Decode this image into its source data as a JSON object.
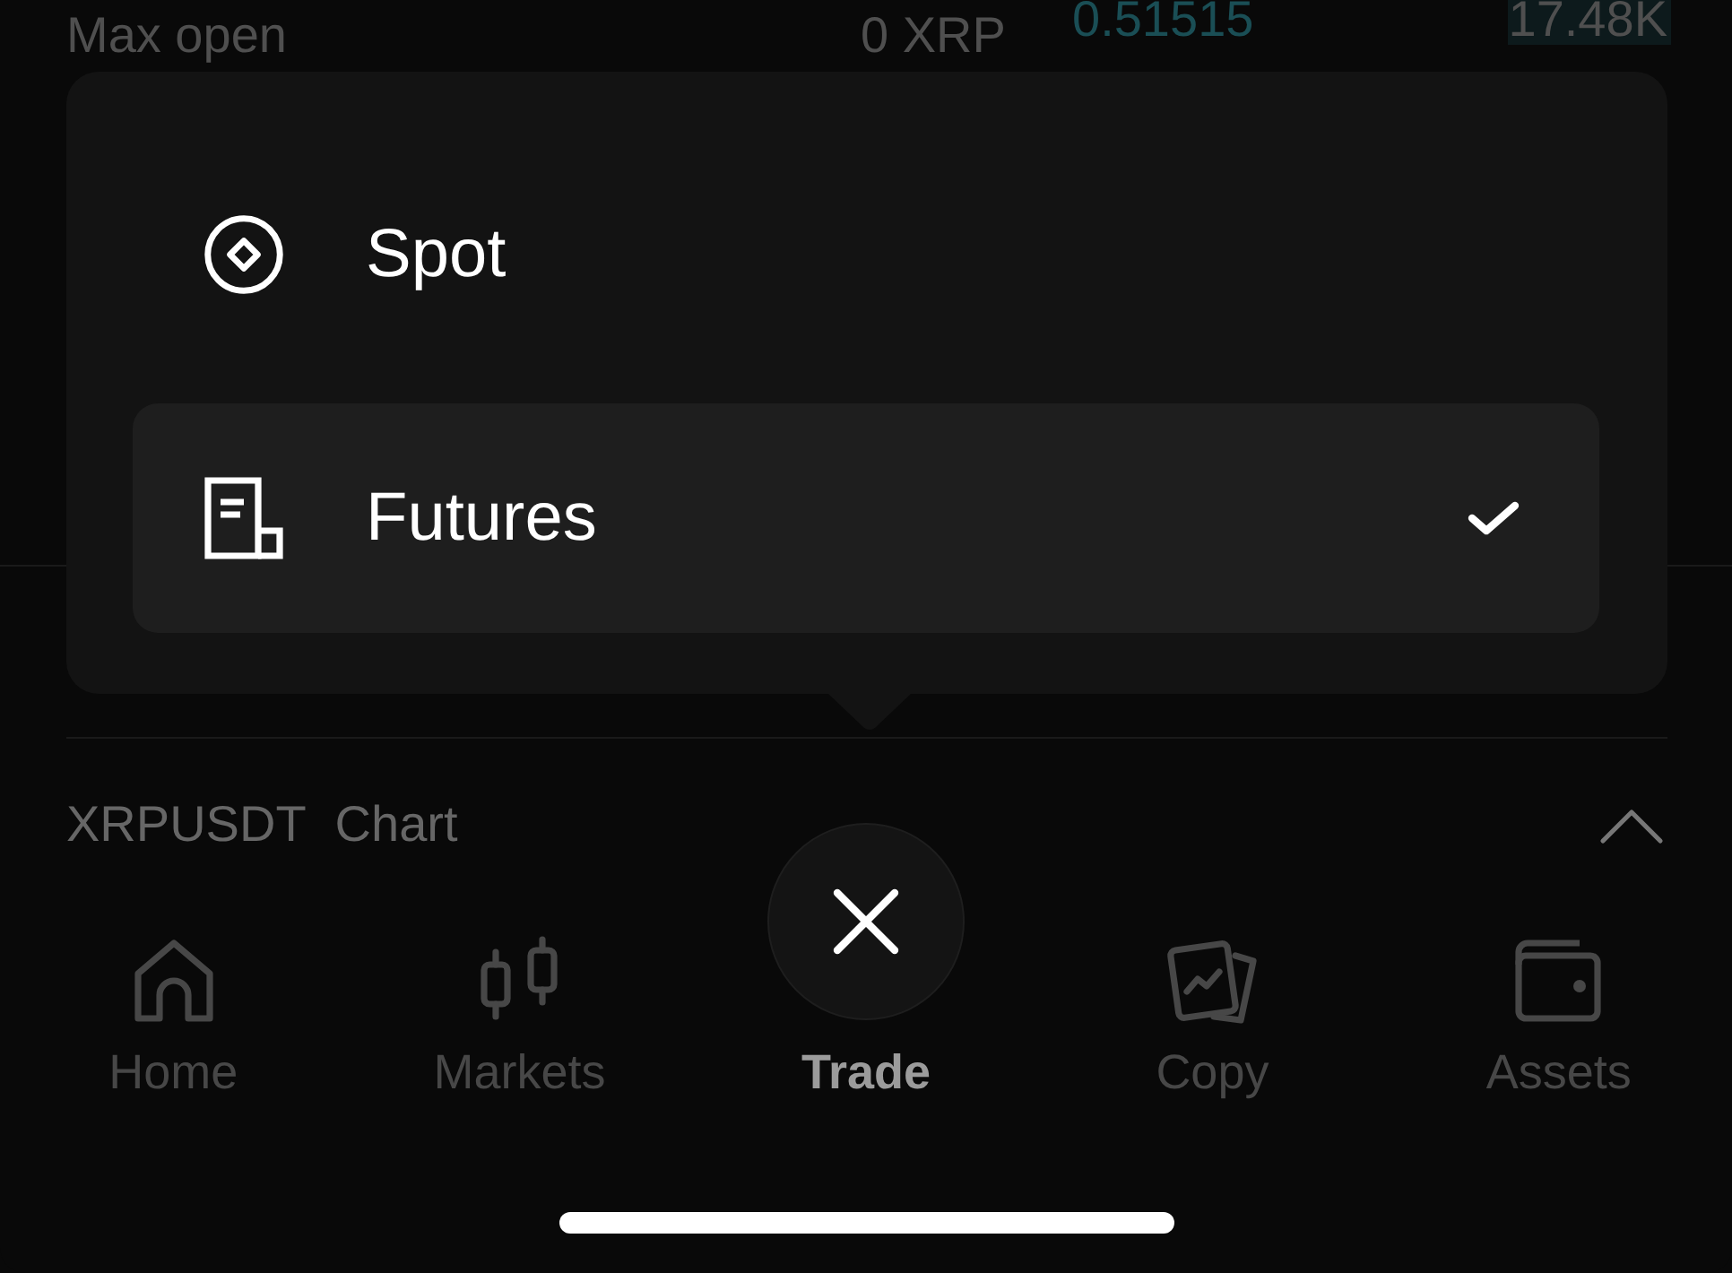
{
  "order_form": {
    "max_open_label": "Max open",
    "max_open_value": "0 XRP"
  },
  "order_book": {
    "rows": [
      {
        "price": "0.51515",
        "amount": "17.48K"
      }
    ]
  },
  "trading_menu": {
    "items": [
      {
        "kind": "spot",
        "label": "Spot",
        "selected": false
      },
      {
        "kind": "futures",
        "label": "Futures",
        "selected": true
      }
    ]
  },
  "chart_bar": {
    "symbol": "XRPUSDT",
    "label": "Chart"
  },
  "tab_bar": {
    "items": [
      {
        "kind": "home",
        "label": "Home",
        "selected": false
      },
      {
        "kind": "markets",
        "label": "Markets",
        "selected": false
      },
      {
        "kind": "trade",
        "label": "Trade",
        "selected": true
      },
      {
        "kind": "copy",
        "label": "Copy",
        "selected": false
      },
      {
        "kind": "assets",
        "label": "Assets",
        "selected": false
      }
    ]
  }
}
